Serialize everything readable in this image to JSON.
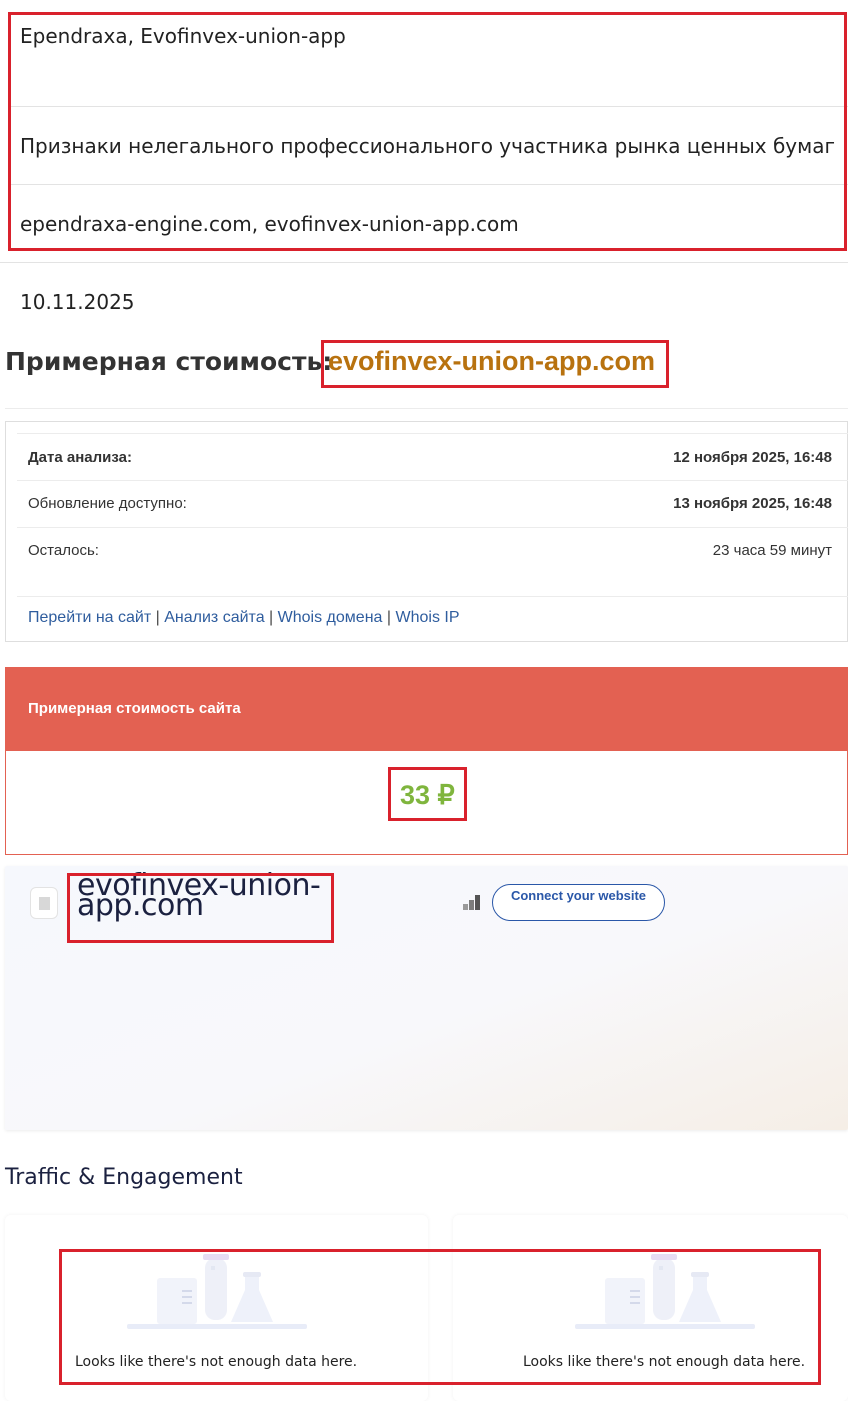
{
  "site_info": {
    "names": "Ependraxa, Evofinvex-union-app",
    "category": "Признаки нелегального профессионального участника рынка ценных бумаг",
    "domains": "ependraxa-engine.com, evofinvex-union-app.com",
    "date": "10.11.2025"
  },
  "price_section": {
    "heading": "Примерная стоимость:",
    "domain": "evofinvex-union-app.com"
  },
  "analysis": {
    "rows": [
      {
        "label": "Дата анализа:",
        "value": "12 ноября 2025, 16:48"
      },
      {
        "label": "Обновление доступно:",
        "value": "13 ноября 2025, 16:48"
      },
      {
        "label": "Осталось:",
        "value": "23 часа 59 минут"
      }
    ],
    "links": [
      "Перейти на сайт",
      "Анализ сайта",
      "Whois домена",
      "Whois IP"
    ],
    "separator": "|"
  },
  "cost": {
    "title": "Примерная стоимость сайта",
    "value": "33 ₽"
  },
  "similarweb": {
    "domain": "evofinvex-union-app.com",
    "connect_button": "Connect your website",
    "traffic_title": "Traffic & Engagement",
    "no_data_left": "Looks like there's not enough data here.",
    "no_data_right": "Looks like there's not enough data here."
  },
  "colors": {
    "highlight_border": "#d9212c",
    "domain_orange": "#b8720f",
    "cost_header": "#e36152",
    "cost_value": "#7fb53d",
    "link_blue": "#2f5d9e",
    "sw_blue": "#2a57a8"
  }
}
